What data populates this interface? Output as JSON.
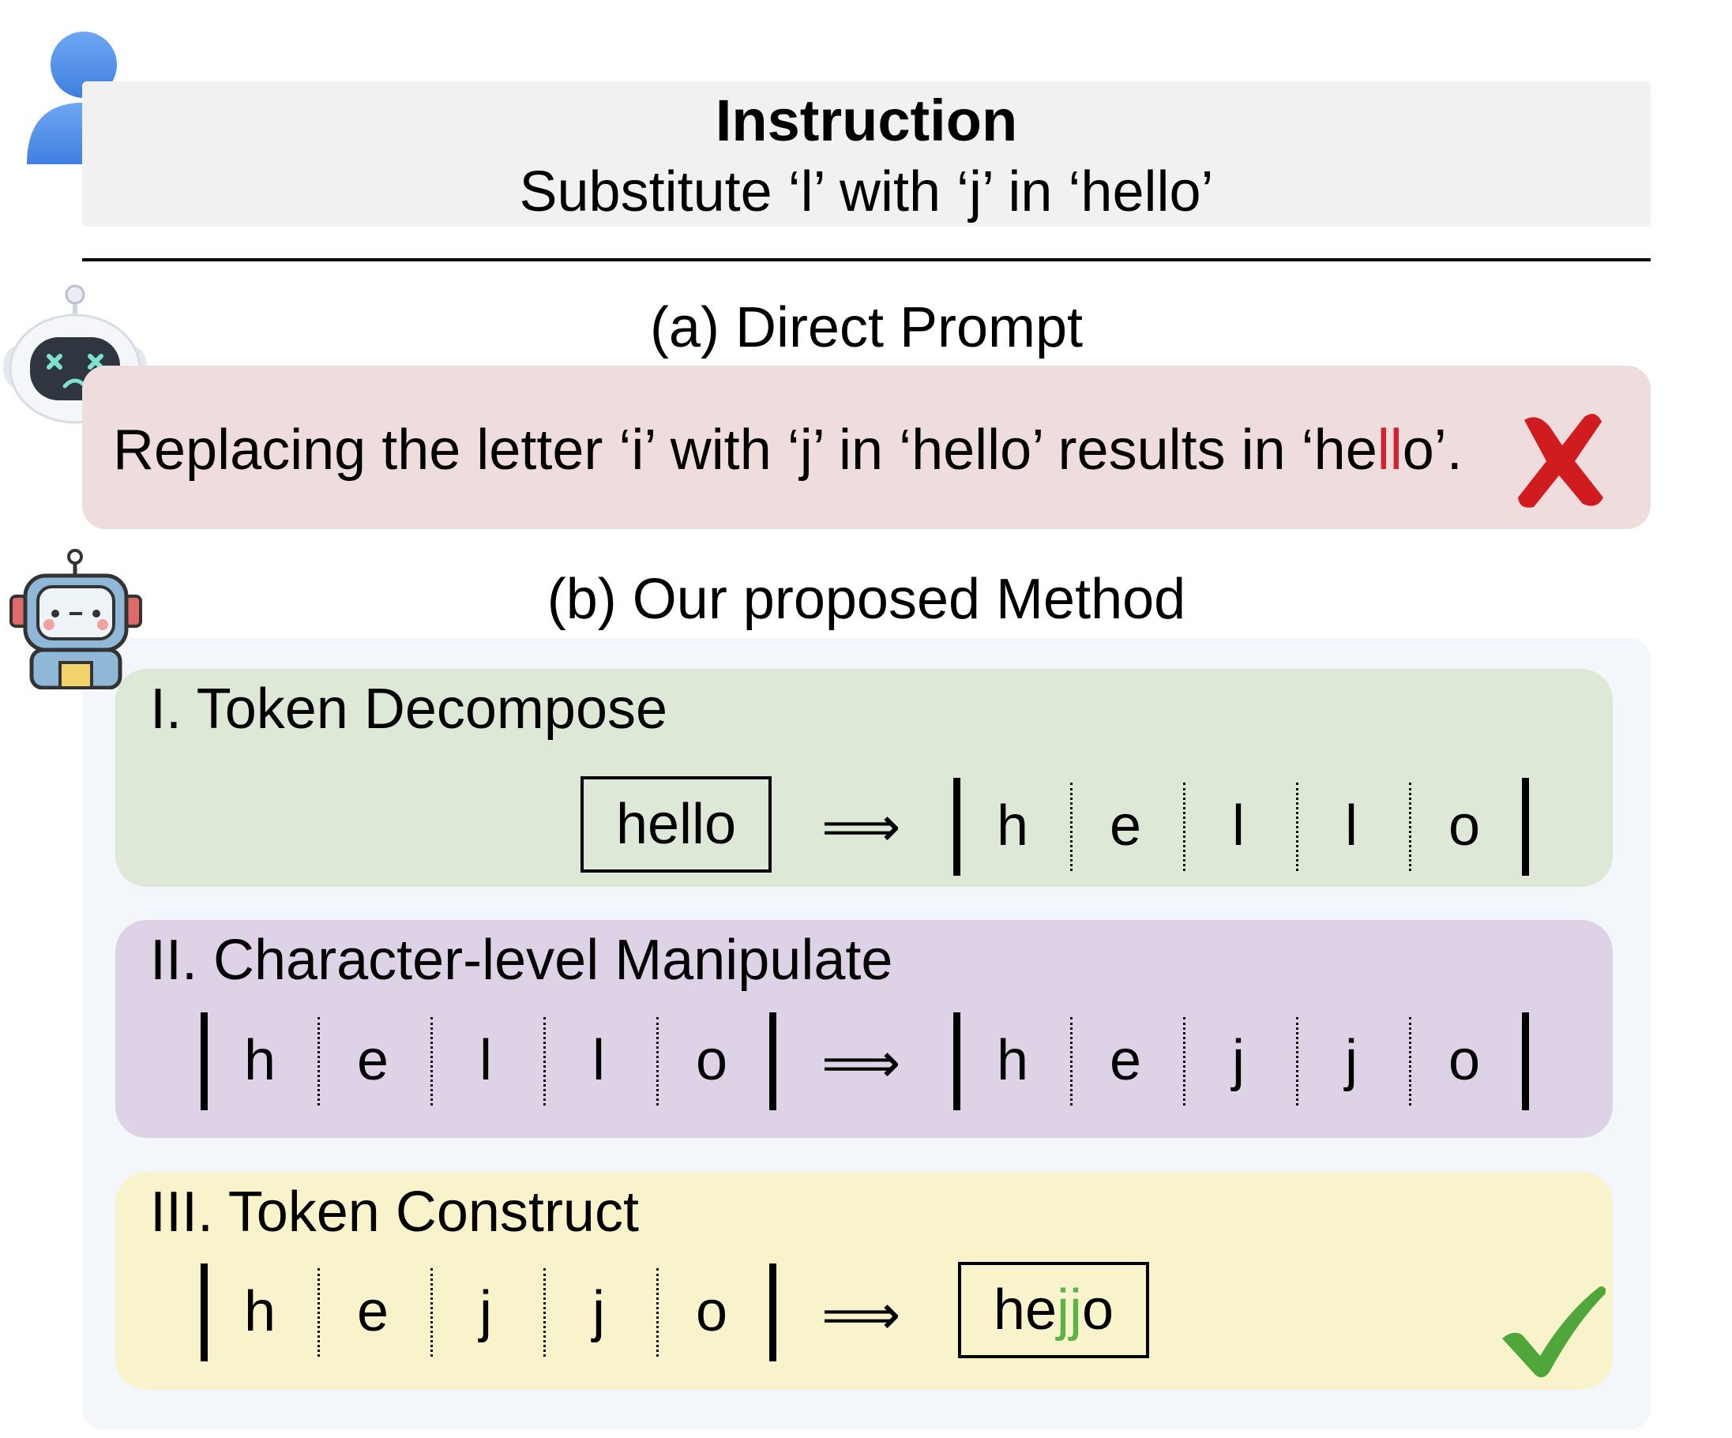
{
  "instruction": {
    "title": "Instruction",
    "text": "Substitute ‘l’ with ‘j’ in ‘hello’"
  },
  "direct_prompt": {
    "title": "(a) Direct Prompt",
    "response_before": "Replacing the letter ‘i’ with ‘j’ in ‘hello’ results in ‘he",
    "response_highlight": "ll",
    "response_after": "o’."
  },
  "method": {
    "title": "(b) Our proposed Method",
    "steps": [
      {
        "title": "I. Token Decompose",
        "input_token": "hello",
        "arrow": "⟹",
        "output_chars": [
          "h",
          "e",
          "l",
          "l",
          "o"
        ]
      },
      {
        "title": "II. Character-level Manipulate",
        "input_chars": [
          "h",
          "e",
          "l",
          "l",
          "o"
        ],
        "arrow": "⟹",
        "output_chars": [
          "h",
          "e",
          "j",
          "j",
          "o"
        ]
      },
      {
        "title": "III. Token Construct",
        "input_chars": [
          "h",
          "e",
          "j",
          "j",
          "o"
        ],
        "arrow": "⟹",
        "output_token_before": "he",
        "output_token_highlight": "jj",
        "output_token_after": "o"
      }
    ]
  },
  "icons": {
    "user": "user-icon",
    "fail_robot": "sad-robot-icon",
    "success_robot": "happy-robot-icon",
    "fail_mark": "cross-mark-icon",
    "success_mark": "check-mark-icon"
  },
  "colors": {
    "error_highlight": "#d4202a",
    "success_highlight": "#5cb346",
    "step1_bg": "#dde8d6",
    "step2_bg": "#ded3e6",
    "step3_bg": "#f9f3cc",
    "direct_bg": "#efdcdc"
  }
}
